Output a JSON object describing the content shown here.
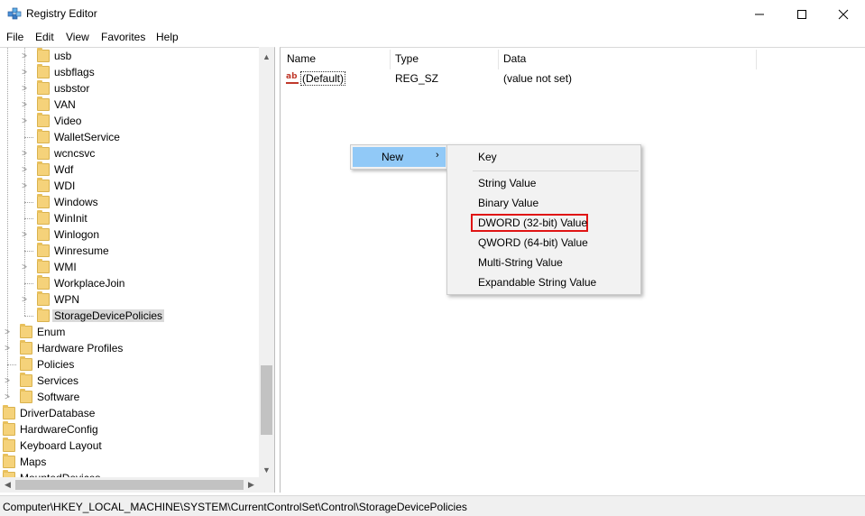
{
  "window": {
    "title": "Registry Editor",
    "controls": {
      "minimize": "—",
      "maximize": "☐",
      "close": "✕"
    }
  },
  "menu": [
    "File",
    "Edit",
    "View",
    "Favorites",
    "Help"
  ],
  "tree": {
    "items": [
      {
        "label": "usb",
        "expandable": true
      },
      {
        "label": "usbflags",
        "expandable": true
      },
      {
        "label": "usbstor",
        "expandable": true
      },
      {
        "label": "VAN",
        "expandable": true
      },
      {
        "label": "Video",
        "expandable": true
      },
      {
        "label": "WalletService",
        "expandable": false
      },
      {
        "label": "wcncsvc",
        "expandable": true
      },
      {
        "label": "Wdf",
        "expandable": true
      },
      {
        "label": "WDI",
        "expandable": true
      },
      {
        "label": "Windows",
        "expandable": false
      },
      {
        "label": "WinInit",
        "expandable": false
      },
      {
        "label": "Winlogon",
        "expandable": true
      },
      {
        "label": "Winresume",
        "expandable": false
      },
      {
        "label": "WMI",
        "expandable": true
      },
      {
        "label": "WorkplaceJoin",
        "expandable": false
      },
      {
        "label": "WPN",
        "expandable": true
      },
      {
        "label": "StorageDevicePolicies",
        "expandable": false,
        "selected": true
      },
      {
        "label": "Enum",
        "expandable": true
      },
      {
        "label": "Hardware Profiles",
        "expandable": true
      },
      {
        "label": "Policies",
        "expandable": false
      },
      {
        "label": "Services",
        "expandable": true
      },
      {
        "label": "Software",
        "expandable": true
      },
      {
        "label": "DriverDatabase",
        "expandable": false
      },
      {
        "label": "HardwareConfig",
        "expandable": false
      },
      {
        "label": "Keyboard Layout",
        "expandable": false
      },
      {
        "label": "Maps",
        "expandable": false
      },
      {
        "label": "MountedDevices",
        "expandable": false
      }
    ]
  },
  "values_pane": {
    "columns": [
      "Name",
      "Type",
      "Data"
    ],
    "rows": [
      {
        "icon": "string-value-icon",
        "icon_text": "ab",
        "name": "(Default)",
        "type": "REG_SZ",
        "data": "(value not set)"
      }
    ]
  },
  "context_menu": {
    "item": "New",
    "arrow": "›",
    "submenu": [
      "Key",
      "String Value",
      "Binary Value",
      "DWORD (32-bit) Value",
      "QWORD (64-bit) Value",
      "Multi-String Value",
      "Expandable String Value"
    ],
    "highlighted": "DWORD (32-bit) Value",
    "highlight_color": "#e01414",
    "hover_color": "#91c9f7"
  },
  "statusbar": {
    "path": "Computer\\HKEY_LOCAL_MACHINE\\SYSTEM\\CurrentControlSet\\Control\\StorageDevicePolicies"
  }
}
